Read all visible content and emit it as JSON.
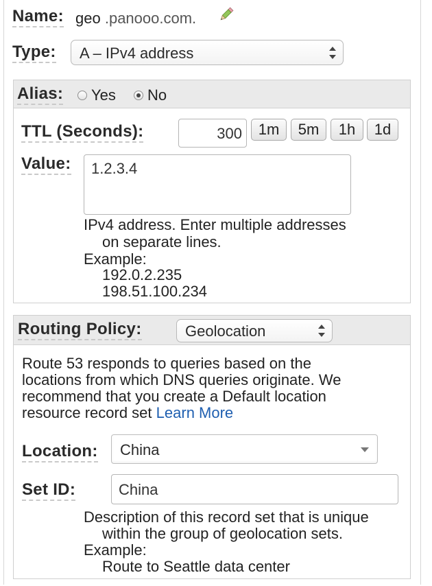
{
  "name": {
    "label": "Name:",
    "value_prefix": "geo",
    "value_domain": ".panooo.com.",
    "edit_icon": "pencil-icon"
  },
  "type": {
    "label": "Type:",
    "selected": "A – IPv4 address"
  },
  "alias": {
    "label": "Alias:",
    "options": [
      "Yes",
      "No"
    ],
    "selected": "No"
  },
  "ttl": {
    "label": "TTL (Seconds):",
    "value": "300",
    "presets": [
      "1m",
      "5m",
      "1h",
      "1d"
    ]
  },
  "value": {
    "label": "Value:",
    "text": "1.2.3.4",
    "help_line1": "IPv4 address. Enter multiple addresses",
    "help_line2": "on separate lines.",
    "example_label": "Example:",
    "example_1": "192.0.2.235",
    "example_2": "198.51.100.234"
  },
  "routing": {
    "label": "Routing Policy:",
    "selected": "Geolocation",
    "desc_line1": "Route 53 responds to queries based on the",
    "desc_line2": "locations from which DNS queries originate. We",
    "desc_line3": "recommend that you create a Default location",
    "desc_line4": "resource record set",
    "learn_more": "Learn More"
  },
  "location": {
    "label": "Location:",
    "selected": "China"
  },
  "set_id": {
    "label": "Set ID:",
    "value": "China",
    "help_line1": "Description of this record set that is unique",
    "help_line2": "within the group of geolocation sets.",
    "example_label": "Example:",
    "example_1": "Route to Seattle data center"
  },
  "colors": {
    "link": "#1f5fb0",
    "section_header": "#eaeaea",
    "border": "#cfcfcf"
  }
}
